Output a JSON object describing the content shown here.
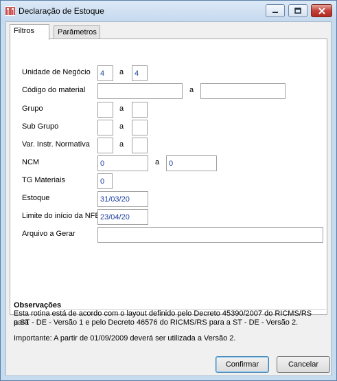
{
  "window": {
    "title": "Declaração de Estoque",
    "accent": "#c12a2a"
  },
  "tabs": [
    {
      "label": "Filtros",
      "active": true
    },
    {
      "label": "Parâmetros",
      "active": false
    }
  ],
  "form": {
    "unidade_negocio": {
      "label": "Unidade de Negócio",
      "from": "4",
      "sep": "a",
      "to": "4"
    },
    "codigo_material": {
      "label": "Código do material",
      "from": "",
      "sep": "a",
      "to": ""
    },
    "grupo": {
      "label": "Grupo",
      "from": "",
      "sep": "a",
      "to": ""
    },
    "sub_grupo": {
      "label": "Sub Grupo",
      "from": "",
      "sep": "a",
      "to": ""
    },
    "var_instr": {
      "label": "Var. Instr. Normativa",
      "from": "",
      "sep": "a",
      "to": ""
    },
    "ncm": {
      "label": "NCM",
      "from": "0",
      "sep": "a",
      "to": "0"
    },
    "tg_materiais": {
      "label": "TG Materiais",
      "value": "0"
    },
    "estoque": {
      "label": "Estoque",
      "value": "31/03/20"
    },
    "limite_nfe": {
      "label": "Limite do início da NFE",
      "value": "23/04/20"
    },
    "arquivo": {
      "label": "Arquivo a Gerar",
      "value": ""
    }
  },
  "observacoes": {
    "title": "Observações",
    "line1": "Esta rotina está de acordo com o layout definido pelo Decreto 45390/2007 do RICMS/RS para",
    "line2": "a ST - DE - Versão 1 e pelo Decreto 46576 do RICMS/RS para a ST - DE - Versão 2.",
    "line3": "Importante: A partir de 01/09/2009 deverá ser utilizada a Versão 2."
  },
  "buttons": {
    "confirmar": "Confirmar",
    "cancelar": "Cancelar"
  }
}
